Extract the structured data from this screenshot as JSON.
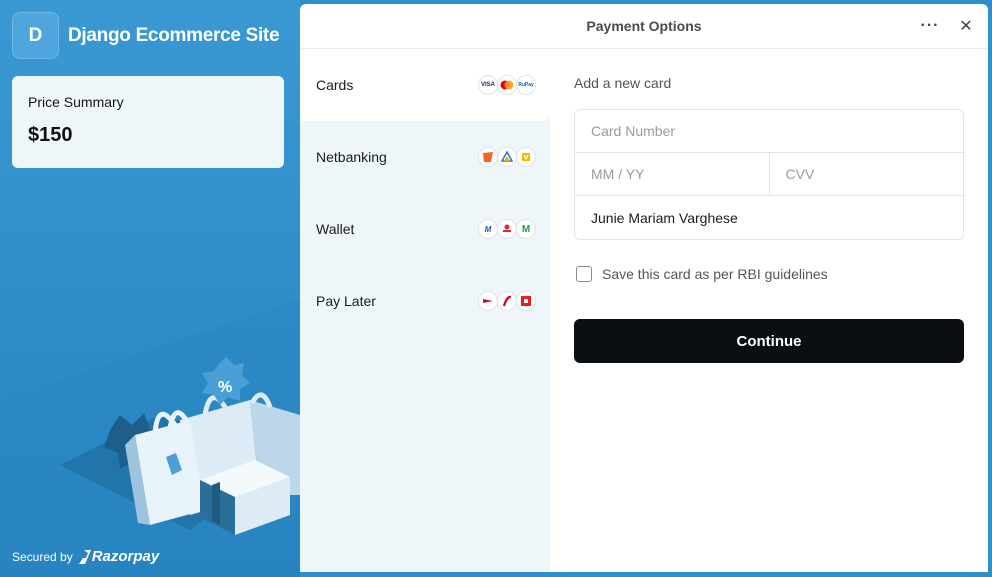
{
  "brand": {
    "initial": "D",
    "name": "Django Ecommerce Site"
  },
  "summary": {
    "label": "Price Summary",
    "amount": "$150"
  },
  "illustration": {
    "discount_symbol": "%"
  },
  "footer": {
    "secured_text": "Secured by",
    "provider": "Razorpay"
  },
  "modal": {
    "title": "Payment Options",
    "more_icon": "ellipsis-icon",
    "close_icon": "close-icon"
  },
  "methods": [
    {
      "label": "Cards",
      "badges": [
        "VISA",
        "MC",
        "RuPay"
      ]
    },
    {
      "label": "Netbanking",
      "badges": [
        "bank-a",
        "bank-b",
        "bank-c"
      ]
    },
    {
      "label": "Wallet",
      "badges": [
        "wallet-a",
        "wallet-b",
        "M"
      ]
    },
    {
      "label": "Pay Later",
      "badges": [
        "later-a",
        "later-b",
        "later-c"
      ]
    }
  ],
  "form": {
    "title": "Add a new card",
    "card_number_placeholder": "Card Number",
    "expiry_placeholder": "MM / YY",
    "cvv_placeholder": "CVV",
    "name_value": "Junie Mariam Varghese",
    "save_label": "Save this card as per RBI guidelines",
    "continue_label": "Continue"
  },
  "colors": {
    "background": "#2f8fcb",
    "panel": "#eef6fa",
    "button": "#0b0f14"
  }
}
